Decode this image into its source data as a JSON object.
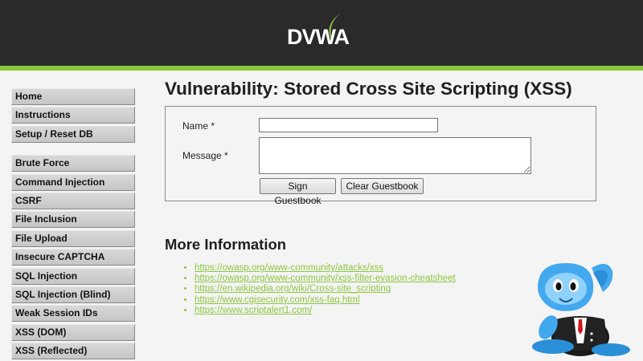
{
  "header": {
    "logo_text": "DVWA"
  },
  "menu": {
    "group1": [
      {
        "label": "Home"
      },
      {
        "label": "Instructions"
      },
      {
        "label": "Setup / Reset DB"
      }
    ],
    "group2": [
      {
        "label": "Brute Force"
      },
      {
        "label": "Command Injection"
      },
      {
        "label": "CSRF"
      },
      {
        "label": "File Inclusion"
      },
      {
        "label": "File Upload"
      },
      {
        "label": "Insecure CAPTCHA"
      },
      {
        "label": "SQL Injection"
      },
      {
        "label": "SQL Injection (Blind)"
      },
      {
        "label": "Weak Session IDs"
      },
      {
        "label": "XSS (DOM)"
      },
      {
        "label": "XSS (Reflected)"
      }
    ]
  },
  "main": {
    "title": "Vulnerability: Stored Cross Site Scripting (XSS)",
    "form": {
      "name_label": "Name *",
      "name_value": "",
      "message_label": "Message *",
      "message_value": "",
      "sign_button": "Sign Guestbook",
      "clear_button": "Clear Guestbook"
    },
    "more_info": {
      "heading": "More Information",
      "links": [
        "https://owasp.org/www-community/attacks/xss",
        "https://owasp.org/www-community/xss-filter-evasion-cheatsheet",
        "https://en.wikipedia.org/wiki/Cross-site_scripting",
        "https://www.cgisecurity.com/xss-faq.html",
        "https://www.scriptalert1.com/"
      ]
    }
  },
  "colors": {
    "header_bg": "#2a2a2a",
    "accent_green": "#8dc63f",
    "menu_bg": "#c8c8c8",
    "page_bg": "#f4f4f4"
  },
  "icons": {
    "mascot": "mascot-icon",
    "logo": "dvwa-logo-icon"
  }
}
